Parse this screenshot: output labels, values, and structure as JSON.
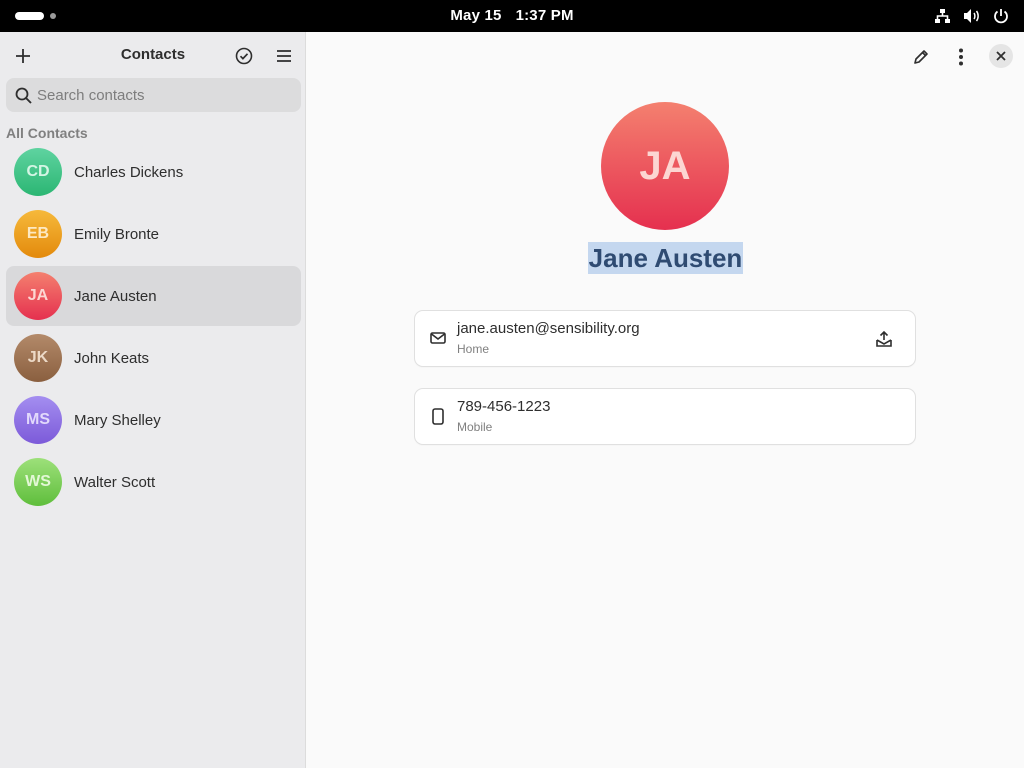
{
  "topbar": {
    "date": "May 15",
    "time": "1:37 PM",
    "tray_icons": [
      "network-icon",
      "volume-icon",
      "power-icon"
    ]
  },
  "sidebar": {
    "title": "Contacts",
    "search_placeholder": "Search contacts",
    "section_label": "All Contacts",
    "contacts": [
      {
        "initials": "CD",
        "name": "Charles Dickens",
        "bg": "linear-gradient(180deg,#5fd3a0,#2bb673)",
        "fg": "#d4f5e4"
      },
      {
        "initials": "EB",
        "name": "Emily Bronte",
        "bg": "linear-gradient(180deg,#f6b93b,#e38a0c)",
        "fg": "#fde9c2"
      },
      {
        "initials": "JA",
        "name": "Jane Austen",
        "bg": "linear-gradient(180deg,#f4806f,#e5304f)",
        "fg": "#fcd6d2",
        "selected": true
      },
      {
        "initials": "JK",
        "name": "John Keats",
        "bg": "linear-gradient(180deg,#b38a6a,#8a5f3f)",
        "fg": "#ecd9c6"
      },
      {
        "initials": "MS",
        "name": "Mary Shelley",
        "bg": "linear-gradient(180deg,#a48ef0,#7c5ad9)",
        "fg": "#e2d9fb"
      },
      {
        "initials": "WS",
        "name": "Walter Scott",
        "bg": "linear-gradient(180deg,#9de07a,#5fbe3c)",
        "fg": "#e3f7d6"
      }
    ]
  },
  "detail": {
    "initials": "JA",
    "name": "Jane Austen",
    "accent": "#e5304f",
    "fields": [
      {
        "icon": "mail-icon",
        "value": "jane.austen@sensibility.org",
        "label": "Home",
        "action_icon": "send-email-icon"
      },
      {
        "icon": "phone-icon",
        "value": "789-456-1223",
        "label": "Mobile"
      }
    ]
  }
}
